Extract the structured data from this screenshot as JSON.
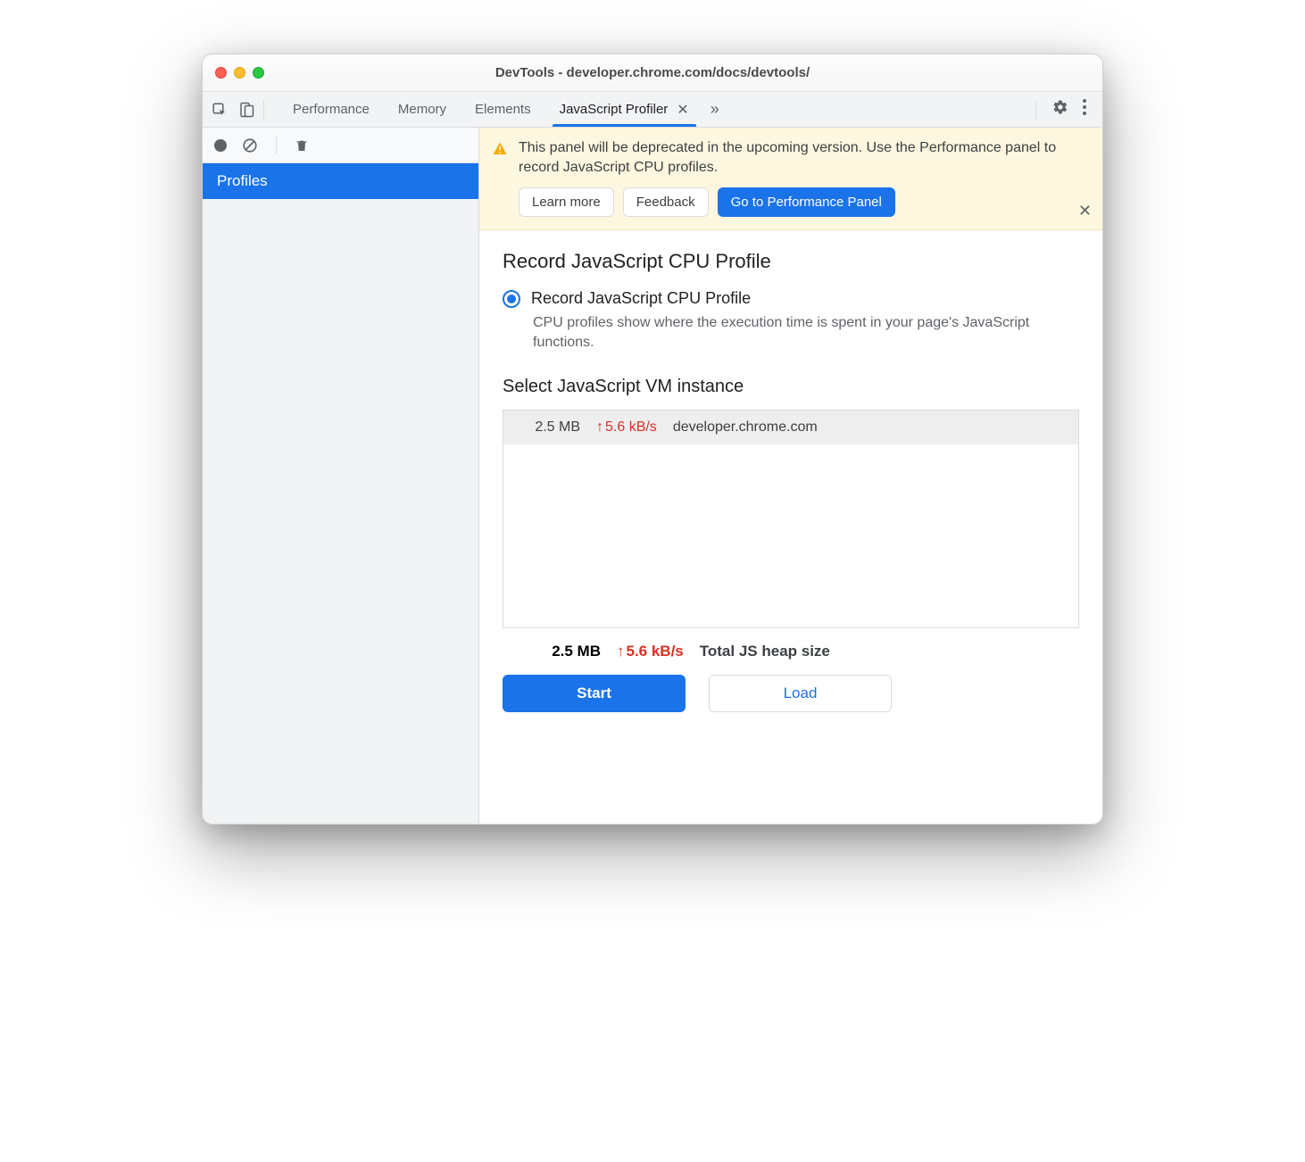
{
  "window": {
    "title": "DevTools - developer.chrome.com/docs/devtools/"
  },
  "tabs": {
    "items": [
      "Performance",
      "Memory",
      "Elements",
      "JavaScript Profiler"
    ],
    "activeIndex": 3
  },
  "sidebar": {
    "profiles_label": "Profiles"
  },
  "banner": {
    "text": "This panel will be deprecated in the upcoming version. Use the Performance panel to record JavaScript CPU profiles.",
    "learn_more": "Learn more",
    "feedback": "Feedback",
    "goto_perf": "Go to Performance Panel"
  },
  "panel": {
    "heading": "Record JavaScript CPU Profile",
    "radio_label": "Record JavaScript CPU Profile",
    "description": "CPU profiles show where the execution time is spent in your page's JavaScript functions.",
    "vm_heading": "Select JavaScript VM instance",
    "vm": {
      "size": "2.5 MB",
      "rate": "5.6 kB/s",
      "host": "developer.chrome.com"
    },
    "totals": {
      "size": "2.5 MB",
      "rate": "5.6 kB/s",
      "label": "Total JS heap size"
    },
    "start": "Start",
    "load": "Load"
  }
}
